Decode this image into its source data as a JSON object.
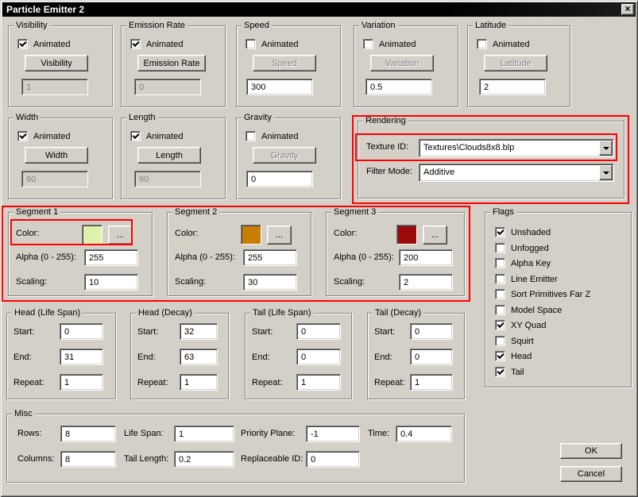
{
  "window": {
    "title": "Particle Emitter 2"
  },
  "icons": {
    "close": "×"
  },
  "anim_groups": [
    {
      "title": "Visibility",
      "animated_label": "Animated",
      "animated": true,
      "button": "Visibility",
      "button_disabled": false,
      "value": "1",
      "field_disabled": true
    },
    {
      "title": "Emission Rate",
      "animated_label": "Animated",
      "animated": true,
      "button": "Emission Rate",
      "button_disabled": false,
      "value": "0",
      "field_disabled": true
    },
    {
      "title": "Speed",
      "animated_label": "Animated",
      "animated": false,
      "button": "Speed",
      "button_disabled": true,
      "value": "300",
      "field_disabled": false
    },
    {
      "title": "Variation",
      "animated_label": "Animated",
      "animated": false,
      "button": "Variation",
      "button_disabled": true,
      "value": "0.5",
      "field_disabled": false
    },
    {
      "title": "Latitude",
      "animated_label": "Animated",
      "animated": false,
      "button": "Latitude",
      "button_disabled": true,
      "value": "2",
      "field_disabled": false
    },
    {
      "title": "Width",
      "animated_label": "Animated",
      "animated": true,
      "button": "Width",
      "button_disabled": false,
      "value": "60",
      "field_disabled": true
    },
    {
      "title": "Length",
      "animated_label": "Animated",
      "animated": true,
      "button": "Length",
      "button_disabled": false,
      "value": "60",
      "field_disabled": true
    },
    {
      "title": "Gravity",
      "animated_label": "Animated",
      "animated": false,
      "button": "Gravity",
      "button_disabled": true,
      "value": "0",
      "field_disabled": false
    }
  ],
  "rendering": {
    "title": "Rendering",
    "texture_label": "Texture ID:",
    "texture_value": "Textures\\Clouds8x8.blp",
    "filter_label": "Filter Mode:",
    "filter_value": "Additive"
  },
  "segments": [
    {
      "title": "Segment 1",
      "color_label": "Color:",
      "color": "#dff2ac",
      "dots": "...",
      "alpha_label": "Alpha (0 - 255):",
      "alpha": "255",
      "scaling_label": "Scaling:",
      "scaling": "10"
    },
    {
      "title": "Segment 2",
      "color_label": "Color:",
      "color": "#c87d04",
      "dots": "...",
      "alpha_label": "Alpha (0 - 255):",
      "alpha": "255",
      "scaling_label": "Scaling:",
      "scaling": "30"
    },
    {
      "title": "Segment 3",
      "color_label": "Color:",
      "color": "#9b0b0b",
      "dots": "...",
      "alpha_label": "Alpha (0 - 255):",
      "alpha": "200",
      "scaling_label": "Scaling:",
      "scaling": "2"
    }
  ],
  "flags": {
    "title": "Flags",
    "items": [
      {
        "label": "Unshaded",
        "checked": true
      },
      {
        "label": "Unfogged",
        "checked": false
      },
      {
        "label": "Alpha Key",
        "checked": false
      },
      {
        "label": "Line Emitter",
        "checked": false
      },
      {
        "label": "Sort Primitives Far Z",
        "checked": false
      },
      {
        "label": "Model Space",
        "checked": false
      },
      {
        "label": "XY Quad",
        "checked": true
      },
      {
        "label": "Squirt",
        "checked": false
      },
      {
        "label": "Head",
        "checked": true
      },
      {
        "label": "Tail",
        "checked": true
      }
    ]
  },
  "lifespan_groups": [
    {
      "title": "Head (Life Span)",
      "start_label": "Start:",
      "start": "0",
      "end_label": "End:",
      "end": "31",
      "repeat_label": "Repeat:",
      "repeat": "1"
    },
    {
      "title": "Head (Decay)",
      "start_label": "Start:",
      "start": "32",
      "end_label": "End:",
      "end": "63",
      "repeat_label": "Repeat:",
      "repeat": "1"
    },
    {
      "title": "Tail (Life Span)",
      "start_label": "Start:",
      "start": "0",
      "end_label": "End:",
      "end": "0",
      "repeat_label": "Repeat:",
      "repeat": "1"
    },
    {
      "title": "Tail (Decay)",
      "start_label": "Start:",
      "start": "0",
      "end_label": "End:",
      "end": "0",
      "repeat_label": "Repeat:",
      "repeat": "1"
    }
  ],
  "misc": {
    "title": "Misc",
    "rows_label": "Rows:",
    "rows": "8",
    "columns_label": "Columns:",
    "columns": "8",
    "lifespan_label": "Life Span:",
    "lifespan": "1",
    "taillength_label": "Tail Length:",
    "taillength": "0.2",
    "priority_label": "Priority Plane:",
    "priority": "-1",
    "replaceable_label": "Replaceable ID:",
    "replaceable": "0",
    "time_label": "Time:",
    "time": "0.4"
  },
  "buttons": {
    "ok": "OK",
    "cancel": "Cancel"
  }
}
